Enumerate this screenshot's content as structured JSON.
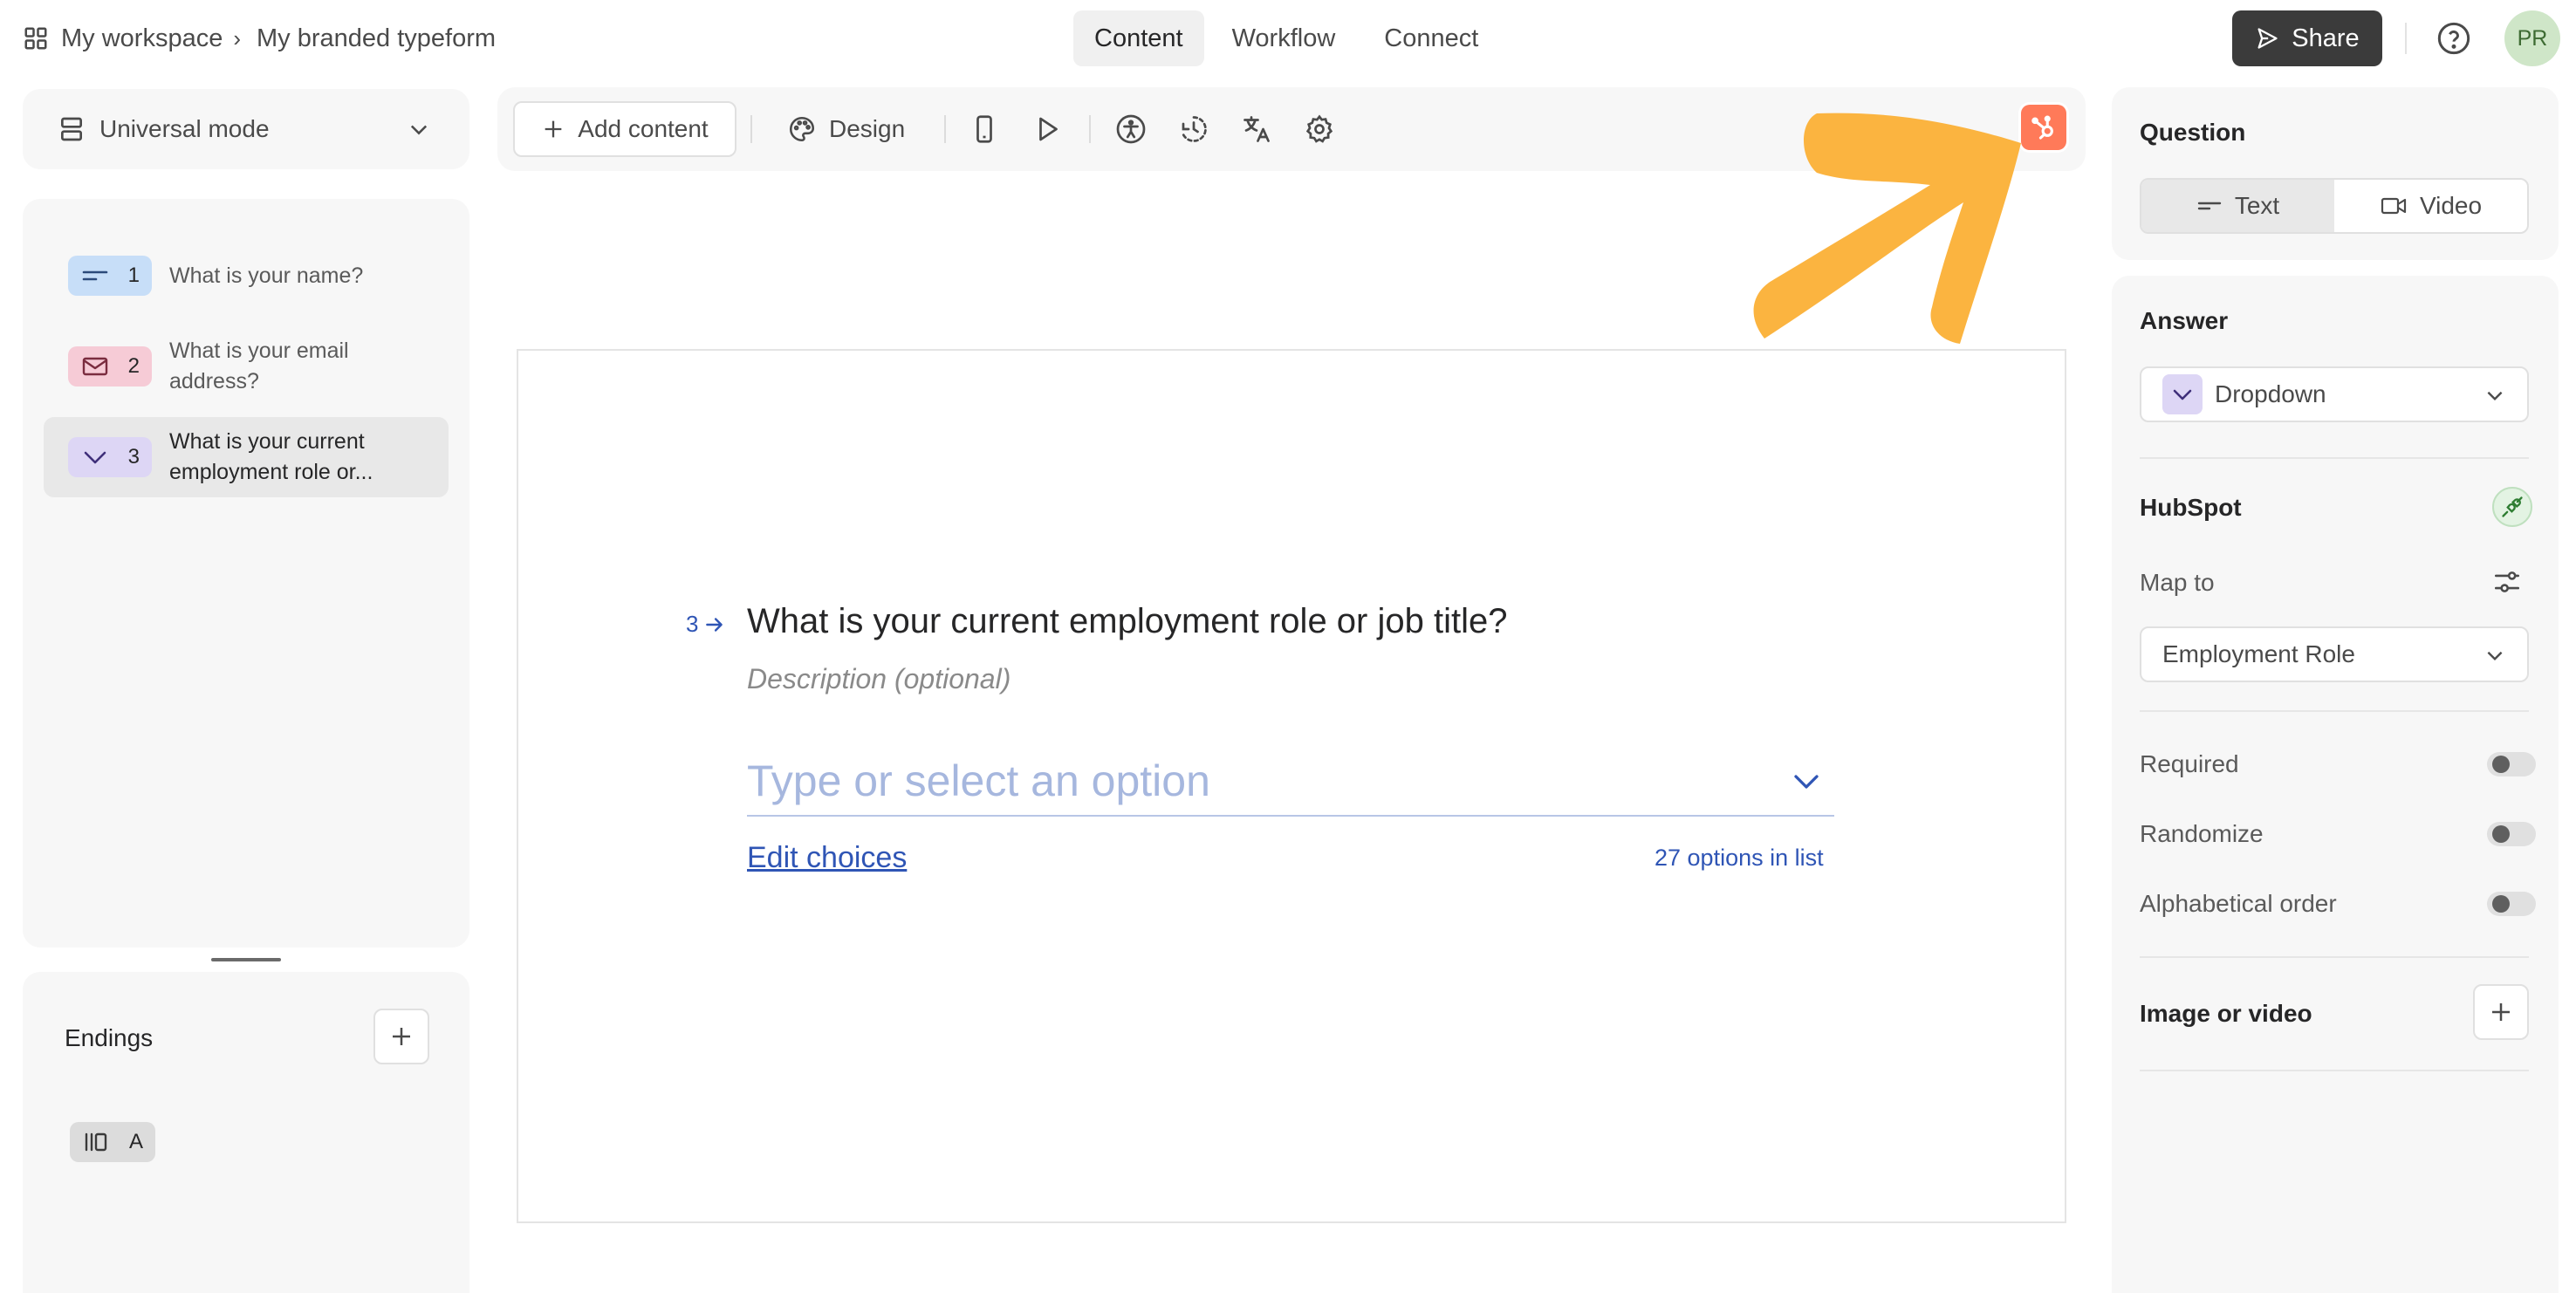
{
  "header": {
    "breadcrumb_workspace": "My workspace",
    "breadcrumb_form": "My branded typeform",
    "tabs": [
      {
        "label": "Content",
        "active": true
      },
      {
        "label": "Workflow",
        "active": false
      },
      {
        "label": "Connect",
        "active": false
      }
    ],
    "share_label": "Share",
    "avatar_initials": "PR"
  },
  "left_panel": {
    "mode_label": "Universal mode",
    "questions": [
      {
        "number": "1",
        "text": "What is your name?",
        "icon": "short-text-icon",
        "color": "#c7def8"
      },
      {
        "number": "2",
        "text": "What is your email address?",
        "icon": "email-icon",
        "color": "#f6cbd6"
      },
      {
        "number": "3",
        "text": "What is your current employment role or...",
        "icon": "dropdown-icon",
        "color": "#ddd6f5",
        "active": true
      }
    ],
    "endings_title": "Endings",
    "ending_label": "A"
  },
  "toolbar": {
    "add_content_label": "Add content",
    "design_label": "Design",
    "icons": [
      "mobile-preview-icon",
      "play-icon",
      "accessibility-icon",
      "logic-icon",
      "translate-icon",
      "settings-icon",
      "hubspot-icon"
    ]
  },
  "canvas": {
    "question_number": "3",
    "question_title": "What is your current employment role or job title?",
    "description_placeholder": "Description (optional)",
    "dropdown_placeholder": "Type or select an option",
    "edit_choices_label": "Edit choices",
    "options_count_label": "27 options in list"
  },
  "right_panel": {
    "question_title": "Question",
    "question_types": [
      {
        "label": "Text",
        "active": true
      },
      {
        "label": "Video",
        "active": false
      }
    ],
    "answer_title": "Answer",
    "answer_type": "Dropdown",
    "hubspot_title": "HubSpot",
    "map_to_label": "Map to",
    "map_to_value": "Employment Role",
    "toggles": [
      {
        "label": "Required",
        "on": false
      },
      {
        "label": "Randomize",
        "on": false
      },
      {
        "label": "Alphabetical order",
        "on": false
      }
    ],
    "image_video_title": "Image or video"
  },
  "colors": {
    "accent_blue": "#2f55b5",
    "hubspot_orange": "#ff7a59",
    "annotation_arrow": "#fbb440",
    "share_bg": "#3b3b3b"
  }
}
